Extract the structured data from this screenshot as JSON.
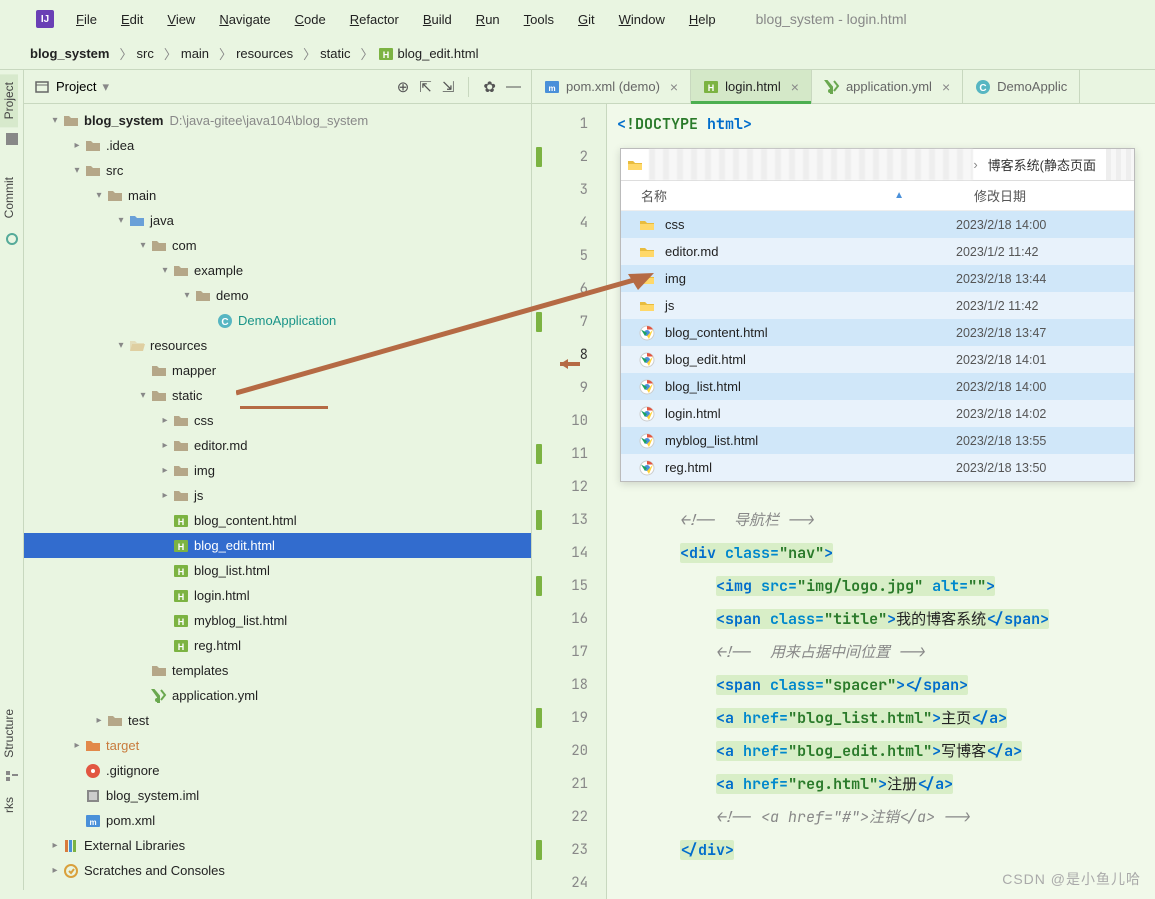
{
  "window_title": "blog_system - login.html",
  "menu": [
    "File",
    "Edit",
    "View",
    "Navigate",
    "Code",
    "Refactor",
    "Build",
    "Run",
    "Tools",
    "Git",
    "Window",
    "Help"
  ],
  "breadcrumbs": [
    "blog_system",
    "src",
    "main",
    "resources",
    "static",
    "blog_edit.html"
  ],
  "left_stripe": {
    "project": "Project",
    "commit": "Commit",
    "structure": "Structure",
    "bookmarks": "rks"
  },
  "project_tool": {
    "title": "Project",
    "root": "blog_system",
    "root_path": "D:\\java-gitee\\java104\\blog_system"
  },
  "tree": [
    {
      "d": 0,
      "exp": "down",
      "icon": "folder-root",
      "label": "blog_system",
      "note": "D:\\java-gitee\\java104\\blog_system",
      "bold": true
    },
    {
      "d": 1,
      "exp": "right",
      "icon": "folder",
      "label": ".idea"
    },
    {
      "d": 1,
      "exp": "down",
      "icon": "folder",
      "label": "src"
    },
    {
      "d": 2,
      "exp": "down",
      "icon": "folder",
      "label": "main"
    },
    {
      "d": 3,
      "exp": "down",
      "icon": "folder-b",
      "label": "java"
    },
    {
      "d": 4,
      "exp": "down",
      "icon": "folder",
      "label": "com"
    },
    {
      "d": 5,
      "exp": "down",
      "icon": "folder",
      "label": "example"
    },
    {
      "d": 6,
      "exp": "down",
      "icon": "folder",
      "label": "demo"
    },
    {
      "d": 7,
      "exp": "",
      "icon": "class",
      "label": "DemoApplication",
      "teal": true
    },
    {
      "d": 3,
      "exp": "down",
      "icon": "folder-r",
      "label": "resources"
    },
    {
      "d": 4,
      "exp": "",
      "icon": "folder",
      "label": "mapper"
    },
    {
      "d": 4,
      "exp": "down",
      "icon": "folder",
      "label": "static"
    },
    {
      "d": 5,
      "exp": "right",
      "icon": "folder",
      "label": "css"
    },
    {
      "d": 5,
      "exp": "right",
      "icon": "folder",
      "label": "editor.md"
    },
    {
      "d": 5,
      "exp": "right",
      "icon": "folder",
      "label": "img"
    },
    {
      "d": 5,
      "exp": "right",
      "icon": "folder",
      "label": "js"
    },
    {
      "d": 5,
      "exp": "",
      "icon": "html",
      "label": "blog_content.html"
    },
    {
      "d": 5,
      "exp": "",
      "icon": "html",
      "label": "blog_edit.html",
      "selected": true
    },
    {
      "d": 5,
      "exp": "",
      "icon": "html",
      "label": "blog_list.html"
    },
    {
      "d": 5,
      "exp": "",
      "icon": "html",
      "label": "login.html"
    },
    {
      "d": 5,
      "exp": "",
      "icon": "html",
      "label": "myblog_list.html"
    },
    {
      "d": 5,
      "exp": "",
      "icon": "html",
      "label": "reg.html"
    },
    {
      "d": 4,
      "exp": "",
      "icon": "folder",
      "label": "templates"
    },
    {
      "d": 4,
      "exp": "",
      "icon": "yml",
      "label": "application.yml"
    },
    {
      "d": 2,
      "exp": "right",
      "icon": "folder",
      "label": "test"
    },
    {
      "d": 1,
      "exp": "right",
      "icon": "target",
      "label": "target",
      "target": true
    },
    {
      "d": 1,
      "exp": "",
      "icon": "git",
      "label": ".gitignore"
    },
    {
      "d": 1,
      "exp": "",
      "icon": "iml",
      "label": "blog_system.iml"
    },
    {
      "d": 1,
      "exp": "",
      "icon": "xml",
      "label": "pom.xml"
    },
    {
      "d": 0,
      "exp": "right",
      "icon": "lib",
      "label": "External Libraries"
    },
    {
      "d": 0,
      "exp": "right",
      "icon": "scratch",
      "label": "Scratches and Consoles"
    }
  ],
  "tabs": [
    {
      "icon": "xml",
      "label": "pom.xml (demo)",
      "active": false
    },
    {
      "icon": "html",
      "label": "login.html",
      "active": true
    },
    {
      "icon": "yml",
      "label": "application.yml",
      "active": false
    },
    {
      "icon": "class",
      "label": "DemoApplic",
      "active": false,
      "noclose": true
    }
  ],
  "lines": [
    1,
    2,
    3,
    4,
    5,
    6,
    7,
    8,
    9,
    10,
    11,
    12,
    13,
    14,
    15,
    16,
    17,
    18,
    19,
    20,
    21,
    22,
    23,
    24
  ],
  "current_line": 8,
  "explorer": {
    "crumb_last": "博客系统(静态页面",
    "col_name": "名称",
    "col_date": "修改日期",
    "rows": [
      {
        "icon": "yfolder",
        "name": "css",
        "date": "2023/2/18 14:00"
      },
      {
        "icon": "yfolder",
        "name": "editor.md",
        "date": "2023/1/2 11:42"
      },
      {
        "icon": "yfolder",
        "name": "img",
        "date": "2023/2/18 13:44"
      },
      {
        "icon": "yfolder",
        "name": "js",
        "date": "2023/1/2 11:42"
      },
      {
        "icon": "chrome",
        "name": "blog_content.html",
        "date": "2023/2/18 13:47"
      },
      {
        "icon": "chrome",
        "name": "blog_edit.html",
        "date": "2023/2/18 14:01"
      },
      {
        "icon": "chrome",
        "name": "blog_list.html",
        "date": "2023/2/18 14:00"
      },
      {
        "icon": "chrome",
        "name": "login.html",
        "date": "2023/2/18 14:02"
      },
      {
        "icon": "chrome",
        "name": "myblog_list.html",
        "date": "2023/2/18 13:55"
      },
      {
        "icon": "chrome",
        "name": "reg.html",
        "date": "2023/2/18 13:50"
      }
    ]
  },
  "code_text": {
    "c13": "导航栏",
    "c14_attr": "\"nav\"",
    "c15_src": "\"img/logo.jpg\"",
    "c15_alt": "\"\"",
    "c16_cls": "\"title\"",
    "c16_txt": "我的博客系统",
    "c17": "用来占据中间位置",
    "c18_cls": "\"spacer\"",
    "c19_href": "\"blog_list.html\"",
    "c19_txt": "主页",
    "c20_href": "\"blog_edit.html\"",
    "c20_txt": "写博客",
    "c21_href": "\"reg.html\"",
    "c21_txt": "注册",
    "c22": "<a href=\"#\">注销</a>"
  },
  "watermark": "CSDN @是小鱼儿哈"
}
